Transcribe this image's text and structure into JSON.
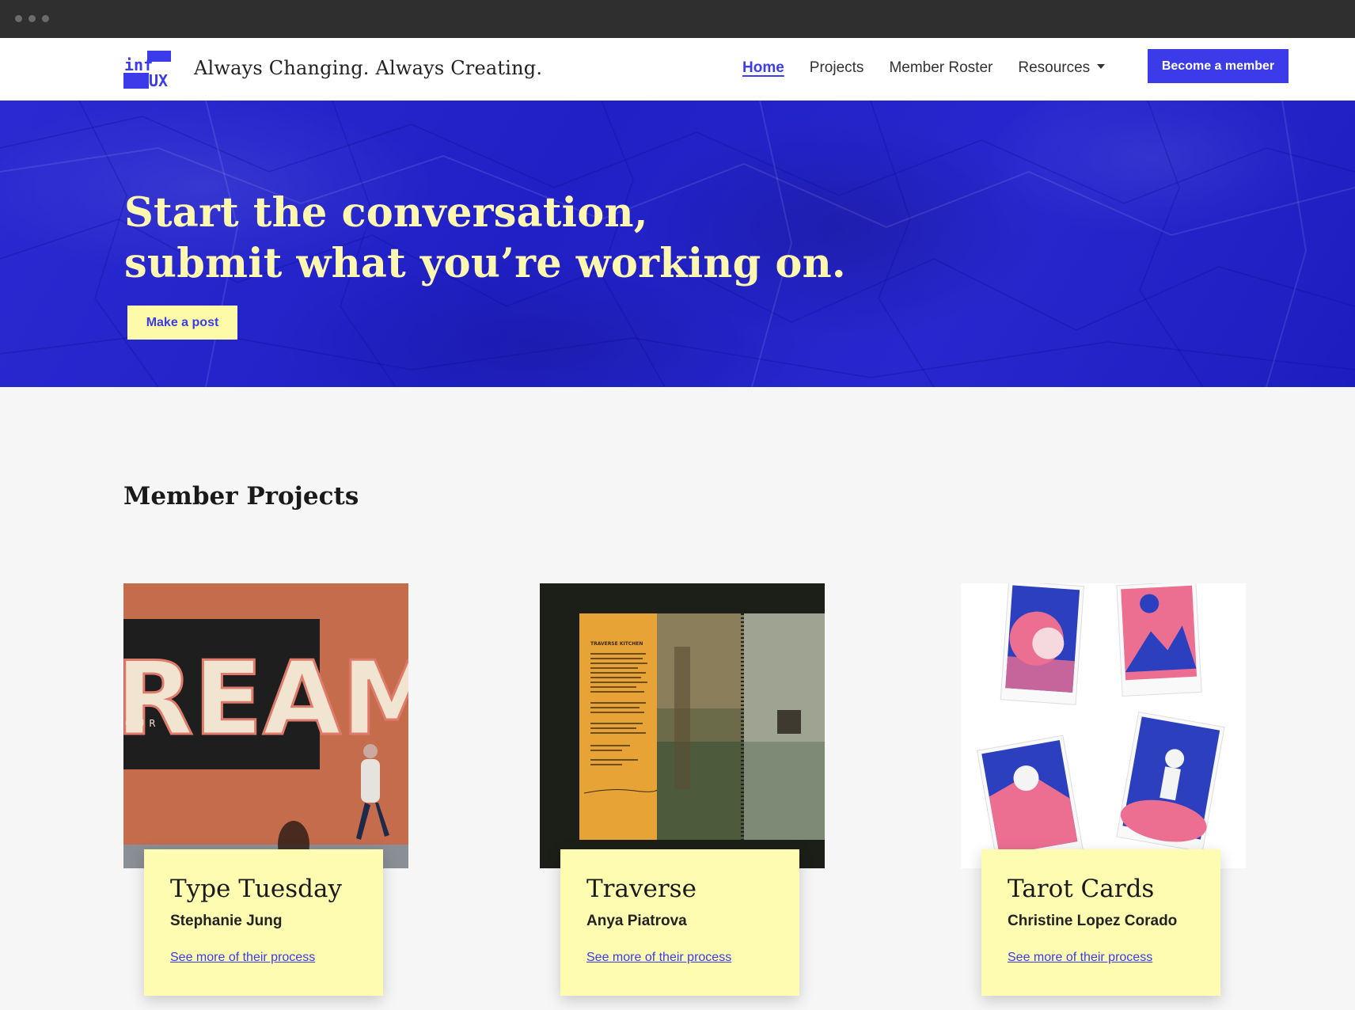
{
  "window": {
    "traffic_lights": 3
  },
  "header": {
    "logo_text": "inf UX",
    "tagline": "Always Changing. Always Creating.",
    "nav": [
      {
        "label": "Home",
        "active": true
      },
      {
        "label": "Projects",
        "active": false
      },
      {
        "label": "Member Roster",
        "active": false
      },
      {
        "label": "Resources",
        "active": false,
        "has_dropdown": true
      }
    ],
    "cta_label": "Become a member"
  },
  "hero": {
    "title_line1": "Start the conversation,",
    "title_line2": "submit what you’re working on.",
    "button_label": "Make a post"
  },
  "projects": {
    "heading": "Member Projects",
    "link_label": "See more of their process",
    "items": [
      {
        "title": "Type Tuesday",
        "author": "Stephanie Jung",
        "link": "See more of their process"
      },
      {
        "title": "Traverse",
        "author": "Anya Piatrova",
        "link": "See more of their process"
      },
      {
        "title": "Tarot Cards",
        "author": "Christine Lopez Corado",
        "link": "See more of their process"
      }
    ],
    "image_1_mural_text": "REAMS",
    "image_1_small_text": "OUR",
    "image_2_heading": "TRAVERSE KITCHEN"
  },
  "colors": {
    "accent": "#3b3bea",
    "hero_bg": "#2424cc",
    "cream": "#fdfaa8",
    "card_bg": "#fdfcb0"
  }
}
